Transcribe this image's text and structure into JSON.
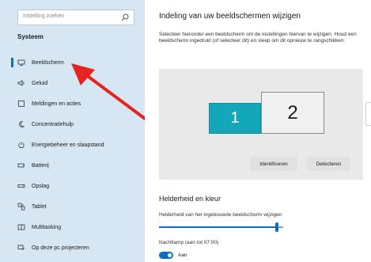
{
  "sidebar": {
    "search_placeholder": "Instelling zoeken",
    "section_title": "Systeem",
    "items": [
      {
        "label": "Beeldscherm",
        "icon": "monitor-icon",
        "active": true
      },
      {
        "label": "Geluid",
        "icon": "speaker-icon"
      },
      {
        "label": "Meldingen en acties",
        "icon": "notification-icon"
      },
      {
        "label": "Concentratiehulp",
        "icon": "moon-icon"
      },
      {
        "label": "Energiebeheer en slaapstand",
        "icon": "power-icon"
      },
      {
        "label": "Batterij",
        "icon": "battery-icon"
      },
      {
        "label": "Opslag",
        "icon": "storage-icon"
      },
      {
        "label": "Tablet",
        "icon": "tablet-icon"
      },
      {
        "label": "Multitasking",
        "icon": "multitasking-icon"
      },
      {
        "label": "Op deze pc projecteren",
        "icon": "project-icon"
      }
    ]
  },
  "main": {
    "title": "Indeling van uw beeldschermen wijzigen",
    "description": "Selecteer hieronder een beeldscherm om de instellingen hiervan te wijzigen. Houd een beeldscherm ingedrukt (of selecteer dit) en sleep om dit opnieuw te rangschikken.",
    "monitors": [
      {
        "label": "1",
        "selected": true
      },
      {
        "label": "2",
        "selected": false
      }
    ],
    "identify_label": "Identificeren",
    "detect_label": "Detecteren",
    "section_title": "Helderheid en kleur",
    "brightness_label": "Helderheid van het ingebouwde beeldscherm wijzigen",
    "brightness_value": 0.95,
    "nightlight_label": "Nachtlamp (aan tot 07:00)",
    "nightlight_state": "Aan"
  },
  "colors": {
    "sidebar_bg": "#d6e6f2",
    "accent": "#0a6fc4",
    "monitor_selected": "#13a7b9",
    "annotation_arrow": "#e8231f"
  }
}
